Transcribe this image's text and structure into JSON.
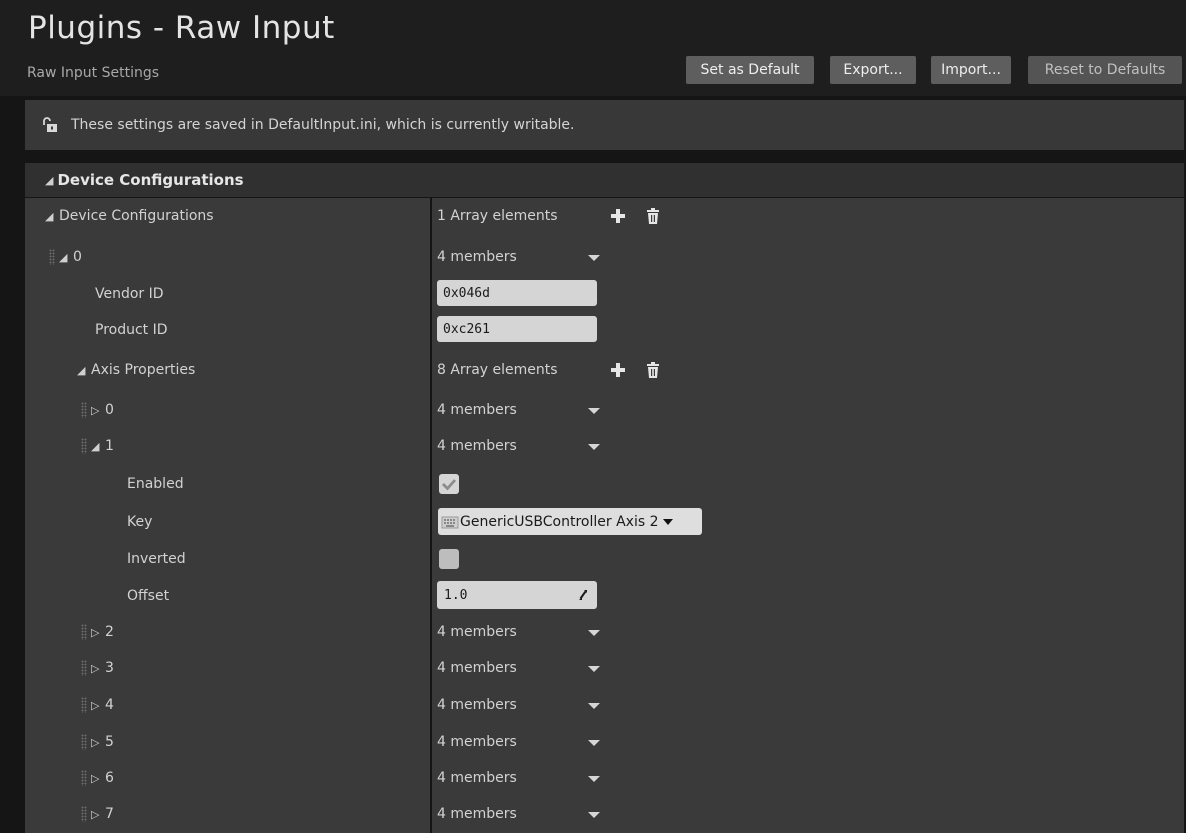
{
  "header": {
    "title": "Plugins - Raw Input",
    "subtitle": "Raw Input Settings",
    "buttons": {
      "set_default": "Set as Default",
      "export": "Export...",
      "import": "Import...",
      "reset": "Reset to Defaults"
    }
  },
  "notice": {
    "icon": "unlock-icon",
    "text": "These settings are saved in DefaultInput.ini, which is currently writable."
  },
  "category": {
    "title": "Device Configurations"
  },
  "rows": {
    "device_configs": {
      "label": "Device Configurations",
      "value": "1 Array elements"
    },
    "device_0": {
      "label": "0",
      "value": "4 members"
    },
    "vendor_id": {
      "label": "Vendor ID",
      "value": "0x046d"
    },
    "product_id": {
      "label": "Product ID",
      "value": "0xc261"
    },
    "axis_props": {
      "label": "Axis Properties",
      "value": "8 Array elements"
    },
    "axis_0": {
      "label": "0",
      "value": "4 members"
    },
    "axis_1": {
      "label": "1",
      "value": "4 members"
    },
    "enabled": {
      "label": "Enabled",
      "checked": true
    },
    "key": {
      "label": "Key",
      "value": "GenericUSBController Axis 2"
    },
    "inverted": {
      "label": "Inverted",
      "checked": false
    },
    "offset": {
      "label": "Offset",
      "value": "1.0"
    },
    "axis_2": {
      "label": "2",
      "value": "4 members"
    },
    "axis_3": {
      "label": "3",
      "value": "4 members"
    },
    "axis_4": {
      "label": "4",
      "value": "4 members"
    },
    "axis_5": {
      "label": "5",
      "value": "4 members"
    },
    "axis_6": {
      "label": "6",
      "value": "4 members"
    },
    "axis_7": {
      "label": "7",
      "value": "4 members"
    }
  },
  "colors": {
    "background": "#151515",
    "panel": "#3a3a3a",
    "button": "#5e5e5e"
  }
}
